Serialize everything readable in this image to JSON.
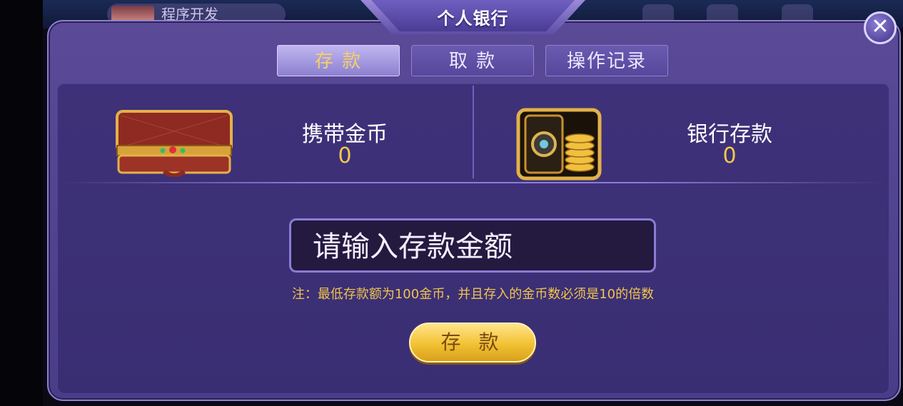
{
  "background": {
    "user_name": "程序开发"
  },
  "dialog": {
    "title": "个人银行",
    "close_symbol": "✕"
  },
  "tabs": [
    {
      "label": "存 款",
      "active": true
    },
    {
      "label": "取 款",
      "active": false
    },
    {
      "label": "操作记录",
      "active": false
    }
  ],
  "wallet": {
    "label": "携带金币",
    "value": "0",
    "icon": "briefcase-icon"
  },
  "bank": {
    "label": "银行存款",
    "value": "0",
    "icon": "safe-icon"
  },
  "deposit_input": {
    "placeholder": "请输入存款金额",
    "value": ""
  },
  "note": "注：最低存款额为100金币，并且存入的金币数必须是10的倍数",
  "deposit_button": "存 款",
  "colors": {
    "accent_gold": "#f2c94c",
    "panel": "#4a3d88",
    "inner": "#3a2e73"
  }
}
